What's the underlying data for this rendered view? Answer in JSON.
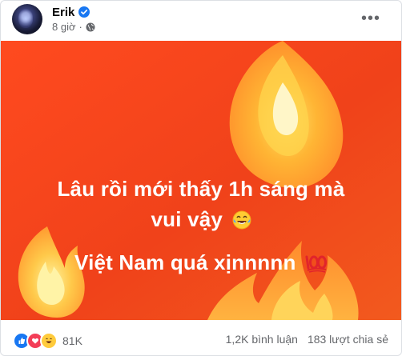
{
  "post": {
    "author": "Erik",
    "time": "8 giờ",
    "headline_line1": "Lâu rồi mới thấy 1h sáng mà",
    "headline_line2": "vui vậy",
    "headline_line3": "Việt Nam quá xịnnnnn",
    "colors": {
      "background": "#f44a1c",
      "text": "#ffffff",
      "verified": "#1877f2",
      "meta": "#65676b"
    }
  },
  "footer": {
    "reaction_count": "81K",
    "comments": "1,2K bình luận",
    "shares": "183 lượt chia sẻ"
  },
  "icons": [
    "verified-icon",
    "globe-icon",
    "more-icon",
    "laughing-emoji-icon",
    "hundred-emoji-icon",
    "fire-icon",
    "like-reaction-icon",
    "love-reaction-icon",
    "haha-reaction-icon"
  ]
}
